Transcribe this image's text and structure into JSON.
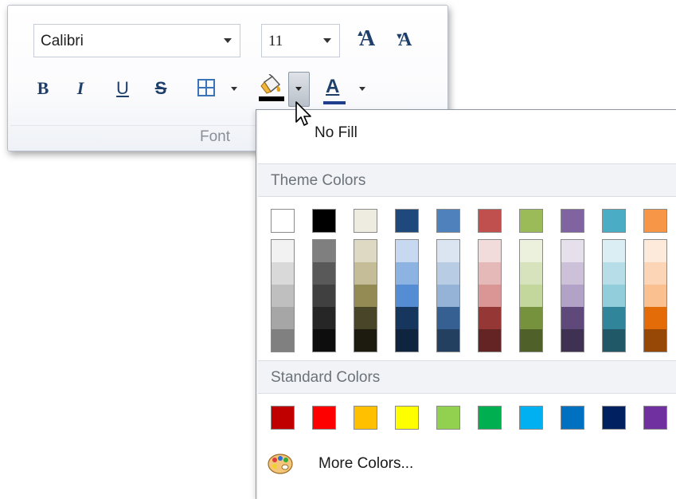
{
  "font_group": {
    "font_name": "Calibri",
    "font_size": "11",
    "grow_label": "A",
    "shrink_label": "A",
    "bold_label": "B",
    "italic_label": "I",
    "underline_label": "U",
    "strike_label": "S",
    "font_color_label": "A",
    "group_label": "Font"
  },
  "dropdown": {
    "no_fill_label": "No Fill",
    "theme_colors_label": "Theme Colors",
    "standard_colors_label": "Standard Colors",
    "more_colors_label": "More Colors..."
  },
  "colors": {
    "theme_base": [
      "#FFFFFF",
      "#000000",
      "#EEECE1",
      "#1F497D",
      "#4F81BD",
      "#C0504D",
      "#9BBB59",
      "#8064A2",
      "#4BACC6",
      "#F79646"
    ],
    "theme_shades": [
      [
        "#F2F2F2",
        "#D9D9D9",
        "#BFBFBF",
        "#A6A6A6",
        "#808080"
      ],
      [
        "#7F7F7F",
        "#595959",
        "#404040",
        "#262626",
        "#0D0D0D"
      ],
      [
        "#DDD9C3",
        "#C4BD97",
        "#948A54",
        "#494529",
        "#1D1B10"
      ],
      [
        "#C6D9F0",
        "#8DB3E2",
        "#548DD4",
        "#17365D",
        "#0F243E"
      ],
      [
        "#DBE5F1",
        "#B8CCE4",
        "#95B3D7",
        "#366092",
        "#244061"
      ],
      [
        "#F2DCDB",
        "#E5B9B7",
        "#D99694",
        "#953734",
        "#632423"
      ],
      [
        "#EBF1DD",
        "#D7E3BC",
        "#C3D69B",
        "#76923C",
        "#4F6128"
      ],
      [
        "#E5E0EC",
        "#CCC1D9",
        "#B2A2C7",
        "#5F497A",
        "#3F3151"
      ],
      [
        "#DBEEF3",
        "#B7DDE8",
        "#92CDDC",
        "#31859B",
        "#205867"
      ],
      [
        "#FDEADA",
        "#FBD5B5",
        "#FAC08F",
        "#E36C09",
        "#974806"
      ]
    ],
    "standard": [
      "#C00000",
      "#FF0000",
      "#FFC000",
      "#FFFF00",
      "#92D050",
      "#00B050",
      "#00B0F0",
      "#0070C0",
      "#002060",
      "#7030A0"
    ]
  },
  "icons": {
    "fill": "fill-color-icon",
    "border": "borders-icon",
    "palette": "palette-icon",
    "cursor": "mouse-cursor-icon"
  }
}
